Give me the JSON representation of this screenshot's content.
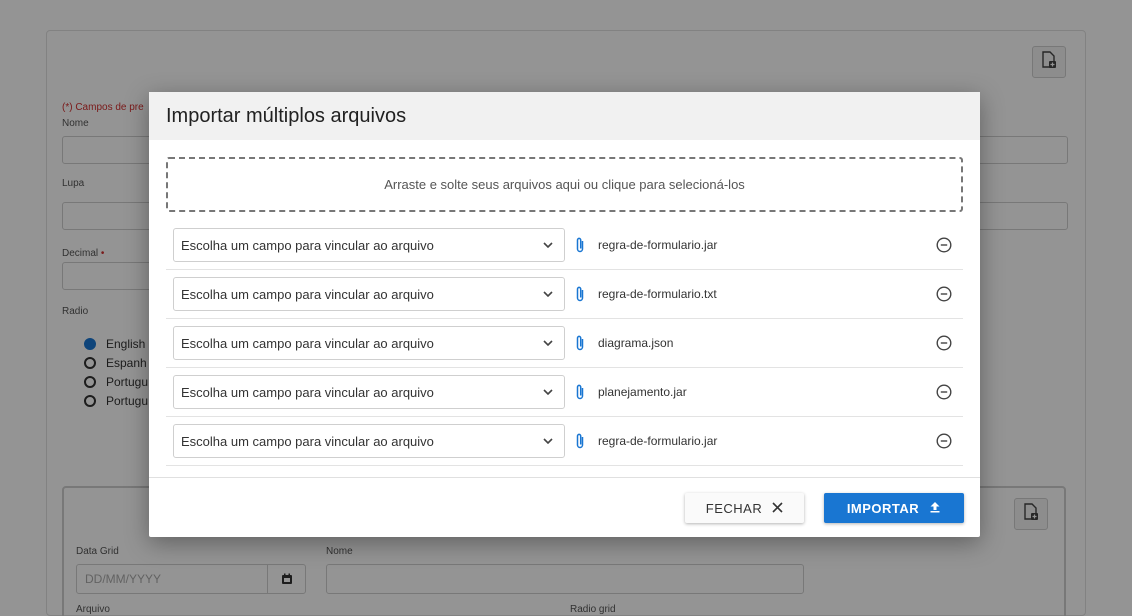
{
  "background": {
    "required_note": "(*) Campos de pre",
    "fields": {
      "nome_label": "Nome",
      "lupa_label": "Lupa",
      "decimal_label": "Decimal",
      "decimal_required_mark": "•",
      "radio_label": "Radio"
    },
    "radio_options": [
      {
        "label": "English",
        "checked": true
      },
      {
        "label": "Espanh",
        "checked": false
      },
      {
        "label": "Portugu",
        "checked": false
      },
      {
        "label": "Portugu",
        "checked": false
      }
    ],
    "sub_form": {
      "data_grid_label": "Data Grid",
      "date_placeholder": "DD/MM/YYYY",
      "nome_label": "Nome",
      "arquivo_label": "Arquivo",
      "radio_grid_label": "Radio grid"
    },
    "icons": {
      "doc_button": "document-add-icon",
      "calendar": "calendar-icon"
    }
  },
  "modal": {
    "title": "Importar múltiplos arquivos",
    "dropzone_text": "Arraste e solte seus arquivos aqui ou clique para selecioná-los",
    "files": [
      {
        "select_placeholder": "Escolha um campo para vincular ao arquivo",
        "file_name": "regra-de-formulario.jar"
      },
      {
        "select_placeholder": "Escolha um campo para vincular ao arquivo",
        "file_name": "regra-de-formulario.txt"
      },
      {
        "select_placeholder": "Escolha um campo para vincular ao arquivo",
        "file_name": "diagrama.json"
      },
      {
        "select_placeholder": "Escolha um campo para vincular ao arquivo",
        "file_name": "planejamento.jar"
      },
      {
        "select_placeholder": "Escolha um campo para vincular ao arquivo",
        "file_name": "regra-de-formulario.jar"
      }
    ],
    "close_label": "FECHAR",
    "import_label": "IMPORTAR",
    "colors": {
      "accent": "#1976d2",
      "clip": "#1976d2",
      "required": "#d32f2f"
    }
  }
}
